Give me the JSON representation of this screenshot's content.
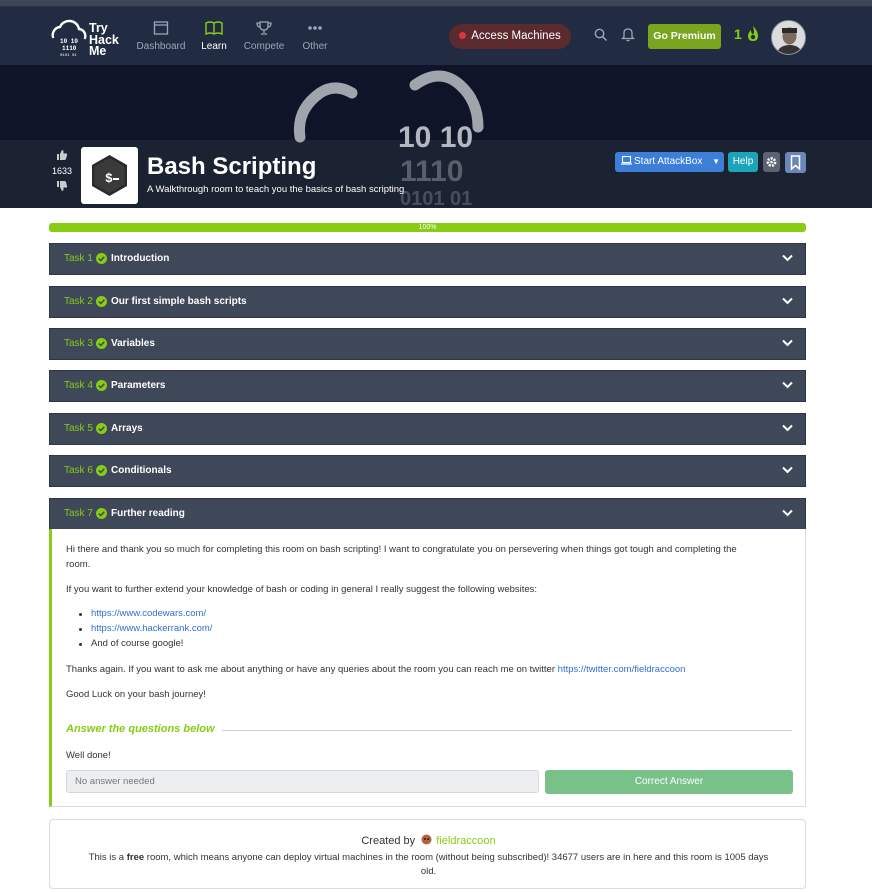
{
  "brand": {
    "logo_lines": [
      "Try",
      "Hack",
      "Me"
    ],
    "logo_digits": [
      "10 10",
      "1110",
      "0101 01"
    ]
  },
  "nav": {
    "items": [
      {
        "label": "Dashboard",
        "icon": "dashboard-icon"
      },
      {
        "label": "Learn",
        "icon": "book-icon",
        "active": true
      },
      {
        "label": "Compete",
        "icon": "trophy-icon"
      },
      {
        "label": "Other",
        "icon": "more-icon"
      }
    ],
    "access_label": "Access Machines",
    "premium_label": "Go Premium",
    "streak": "1"
  },
  "banner": {
    "bg_digits": [
      "10  10",
      "1110",
      "0101  01"
    ]
  },
  "room": {
    "votes": "1633",
    "title": "Bash Scripting",
    "subtitle": "A Walkthrough room to teach you the basics of bash scripting",
    "attackbox_label": "Start AttackBox",
    "help_label": "Help"
  },
  "progress": {
    "label": "100%",
    "fraction": 1.0
  },
  "tasks": [
    {
      "num": "Task 1",
      "name": "Introduction"
    },
    {
      "num": "Task 2",
      "name": "Our first simple bash scripts"
    },
    {
      "num": "Task 3",
      "name": "Variables"
    },
    {
      "num": "Task 4",
      "name": "Parameters"
    },
    {
      "num": "Task 5",
      "name": "Arrays"
    },
    {
      "num": "Task 6",
      "name": "Conditionals"
    },
    {
      "num": "Task 7",
      "name": "Further reading"
    }
  ],
  "task7": {
    "para1_line1": "Hi there and thank you so much for completing this room on bash scripting! I want to congratulate you on persevering when things got tough and completing the",
    "para1_line2": "room.",
    "para2": "If you want to further extend your knowledge of bash or coding in general I really suggest the following websites:",
    "links": [
      "https://www.codewars.com/",
      "https://www.hackerrank.com/"
    ],
    "list_last": "And of course google!",
    "para3_text": "Thanks again. If you want to ask me about anything or have any queries about the room you can reach me on twitter ",
    "para3_link": "https://twitter.com/fieldraccoon",
    "para4": "Good Luck on your bash journey!",
    "answer_heading": "Answer the questions below",
    "question": "Well done!",
    "answer_placeholder": "No answer needed",
    "correct_label": "Correct Answer"
  },
  "footer": {
    "created_by": "Created by",
    "author": "fieldraccoon",
    "line1_pre": "This is a ",
    "line1_bold": "free",
    "line1_post": " room, which means anyone can deploy virtual machines in the room (without being subscribed)! 34677 users are in here and this room is 1005 days",
    "line2": "old."
  },
  "colors": {
    "accent_green": "#88cc14",
    "nav_bg": "#212c42",
    "task_bg": "#3e4858",
    "link_blue": "#2f6fd6"
  }
}
